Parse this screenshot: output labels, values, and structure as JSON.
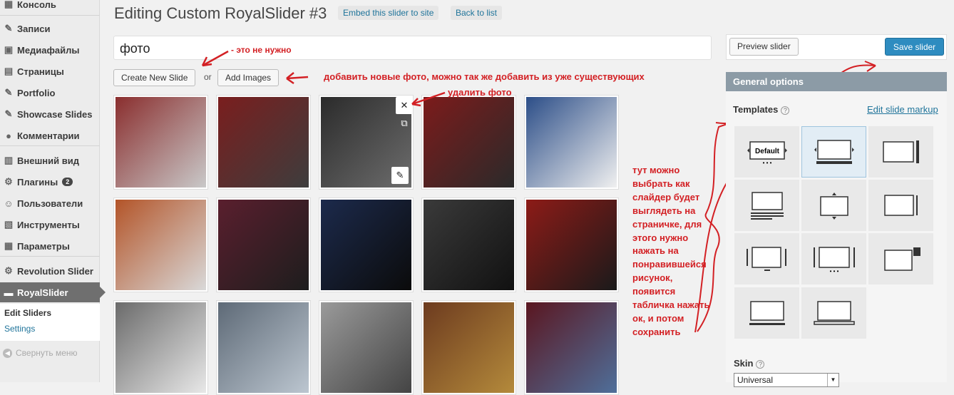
{
  "sidebar": {
    "items": [
      {
        "label": "Консоль",
        "icon": "dashboard-icon",
        "glyph": "▦"
      },
      {
        "label": "Записи",
        "icon": "pin-icon",
        "glyph": "✎"
      },
      {
        "label": "Медиафайлы",
        "icon": "media-icon",
        "glyph": "▣"
      },
      {
        "label": "Страницы",
        "icon": "pages-icon",
        "glyph": "▤"
      },
      {
        "label": "Portfolio",
        "icon": "portfolio-pin-icon",
        "glyph": "✎"
      },
      {
        "label": "Showcase Slides",
        "icon": "showcase-pin-icon",
        "glyph": "✎"
      },
      {
        "label": "Комментарии",
        "icon": "comments-icon",
        "glyph": "●"
      },
      {
        "label": "Внешний вид",
        "icon": "appearance-icon",
        "glyph": "▥"
      },
      {
        "label": "Плагины",
        "icon": "plugins-icon",
        "glyph": "⚙",
        "badge": "2"
      },
      {
        "label": "Пользователи",
        "icon": "users-icon",
        "glyph": "☺"
      },
      {
        "label": "Инструменты",
        "icon": "tools-icon",
        "glyph": "▧"
      },
      {
        "label": "Параметры",
        "icon": "settings-icon",
        "glyph": "▦"
      },
      {
        "label": "Revolution Slider",
        "icon": "gear-icon",
        "glyph": "⚙"
      },
      {
        "label": "RoyalSlider",
        "icon": "royalslider-icon",
        "glyph": "▬"
      }
    ],
    "submenu": {
      "edit": "Edit Sliders",
      "settings": "Settings"
    },
    "collapse": "Свернуть меню"
  },
  "header": {
    "title": "Editing Custom RoyalSlider #3",
    "embed": "Embed this slider to site",
    "back": "Back to list"
  },
  "slider_name": "фото",
  "buttons": {
    "create": "Create New Slide",
    "or": "or",
    "add": "Add Images"
  },
  "annotations": {
    "not_needed": "- это не нужно",
    "add_photos": "добавить новые фото, можно так же добавить из уже существующих",
    "delete_photo": "удалить фото",
    "hint": [
      "тут можно",
      "выбрать как",
      "слайдер будет",
      "выглядеть на",
      "страничке, для",
      "этого нужно",
      "нажать на",
      "понравившейся",
      "рисунок,",
      "появится",
      "табличка нажать",
      "ок, и потом",
      "сохранить"
    ]
  },
  "thumbs": [
    {
      "colors": [
        "#8a2e2e",
        "#c9c9c9"
      ]
    },
    {
      "colors": [
        "#7a1e1e",
        "#3d3d3d"
      ]
    },
    {
      "colors": [
        "#2b2b2b",
        "#6d6d6d"
      ]
    },
    {
      "colors": [
        "#7c1b1b",
        "#2a2a2a"
      ]
    },
    {
      "colors": [
        "#2c4e88",
        "#f0f0f0"
      ]
    },
    {
      "colors": [
        "#b35428",
        "#d9d9d9"
      ]
    },
    {
      "colors": [
        "#5a1f2e",
        "#1d1d1d"
      ]
    },
    {
      "colors": [
        "#1c2a4c",
        "#0b0b0b"
      ]
    },
    {
      "colors": [
        "#3a3a3a",
        "#111"
      ]
    },
    {
      "colors": [
        "#8d1b17",
        "#1a1a1a"
      ]
    },
    {
      "colors": [
        "#6b6b6b",
        "#e8e8e8"
      ]
    },
    {
      "colors": [
        "#5e6a77",
        "#bcc6d0"
      ]
    },
    {
      "colors": [
        "#9a9a9a",
        "#444"
      ]
    },
    {
      "colors": [
        "#6d3b1f",
        "#b48a3b"
      ]
    },
    {
      "colors": [
        "#5a1620",
        "#4f6f9a"
      ]
    }
  ],
  "right": {
    "preview": "Preview slider",
    "save": "Save slider",
    "general": "General options",
    "templates": "Templates",
    "edit_markup": "Edit slide markup",
    "default_tpl": "Default",
    "skin_label": "Skin",
    "skin_value": "Universal"
  }
}
